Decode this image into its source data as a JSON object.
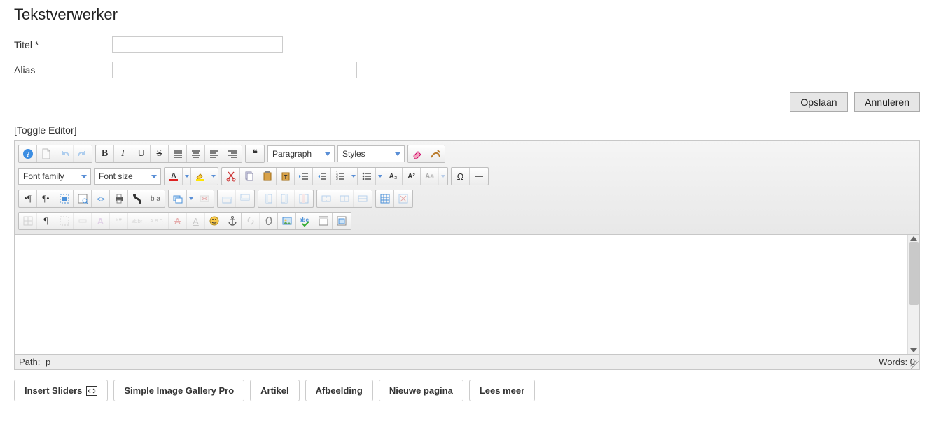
{
  "page": {
    "title": "Tekstverwerker"
  },
  "fields": {
    "title_label": "Titel *",
    "title_value": "",
    "alias_label": "Alias",
    "alias_value": ""
  },
  "actions": {
    "save": "Opslaan",
    "cancel": "Annuleren"
  },
  "editor": {
    "toggle": "[Toggle Editor]",
    "format_select": "Paragraph",
    "styles_select": "Styles",
    "fontfamily_select": "Font family",
    "fontsize_select": "Font size",
    "glyph_bold": "B",
    "glyph_italic": "I",
    "glyph_underline": "U",
    "glyph_strike": "S",
    "glyph_quote": "❝",
    "glyph_subscript": "A₂",
    "glyph_superscript": "A²",
    "glyph_case": "Aa",
    "glyph_omega": "Ω",
    "glyph_abbr": "abbr",
    "glyph_acr": "A.B.C.",
    "glyph_pilcrow": "¶",
    "glyph_ltr": "¶",
    "glyph_rtl": "¶",
    "glyph_ba": "b a",
    "glyph_text_a": "A",
    "glyph_text_a2": "A",
    "glyph_quotes2": "❝❞",
    "status_path_label": "Path:",
    "status_path_value": "p",
    "status_words": "Words: 0"
  },
  "bottom": {
    "insert_sliders": "Insert Sliders",
    "simple_gallery": "Simple Image Gallery Pro",
    "artikel": "Artikel",
    "afbeelding": "Afbeelding",
    "nieuwe_pagina": "Nieuwe pagina",
    "lees_meer": "Lees meer"
  }
}
